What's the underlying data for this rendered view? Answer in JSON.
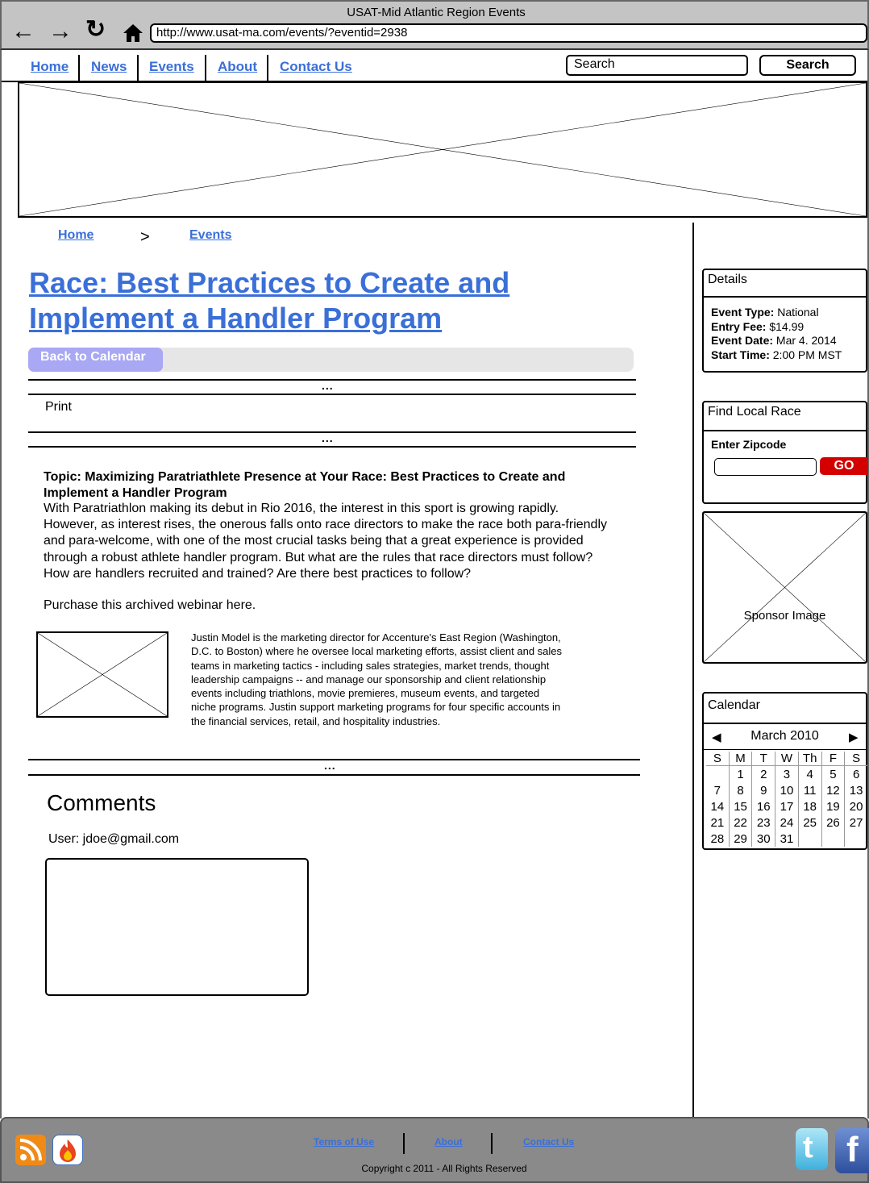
{
  "window": {
    "title": "USAT-Mid Atlantic Region Events",
    "url": "http://www.usat-ma.com/events/?eventid=2938"
  },
  "nav": {
    "items": [
      "Home",
      "News",
      "Events",
      "About",
      "Contact Us"
    ],
    "search_placeholder": "Search",
    "search_button": "Search"
  },
  "breadcrumb": {
    "home": "Home",
    "separator": ">",
    "events": "Events"
  },
  "event": {
    "title_line1": "Race: Best Practices to Create and",
    "title_line2": "Implement a Handler Program",
    "back_button": "Back to Calendar",
    "print_label": "Print",
    "dots": "...",
    "topic_line1": "Topic: Maximizing Paratriathlete Presence at Your Race: Best Practices to Create and",
    "topic_line2": "Implement a Handler Program",
    "body": [
      "With Paratriathlon making its debut in Rio 2016, the interest in this sport is growing rapidly.",
      "However, as interest rises, the onerous falls onto race directors to make the race both para-friendly",
      "and para-welcome, with one of the most crucial tasks being that a great experience is provided",
      "through a robust athlete handler program.  But what are the rules that race directors must follow?",
      "How are handlers recruited and trained?  Are there best practices to follow?"
    ],
    "purchase_text": "Purchase this archived webinar here.",
    "bio": [
      "Justin Model is the marketing director for Accenture's East Region (Washington,",
      "D.C. to Boston) where he oversee local marketing efforts, assist client and sales",
      "teams in marketing tactics - including sales strategies, market trends, thought",
      "leadership campaigns -- and manage our sponsorship and client relationship",
      "events including triathlons, movie premieres, museum events, and targeted",
      "niche programs. Justin support marketing programs for four specific accounts in",
      "the financial services, retail, and hospitality industries."
    ]
  },
  "comments": {
    "heading": "Comments",
    "user_label": "User: jdoe@gmail.com"
  },
  "details": {
    "title": "Details",
    "rows": [
      {
        "label": "Event Type:",
        "value": " National"
      },
      {
        "label": "Entry Fee:",
        "value": " $14.99"
      },
      {
        "label": "Event Date:",
        "value": " Mar 4. 2014"
      },
      {
        "label": "Start Time:",
        "value": " 2:00 PM MST"
      }
    ]
  },
  "find_race": {
    "title": "Find Local Race",
    "label": "Enter Zipcode",
    "go": "GO"
  },
  "sponsor": {
    "label": "Sponsor Image"
  },
  "calendar": {
    "title": "Calendar",
    "month": "March 2010",
    "days": [
      "S",
      "M",
      "T",
      "W",
      "Th",
      "F",
      "S"
    ],
    "weeks": [
      [
        "",
        "1",
        "2",
        "3",
        "4",
        "5",
        "6"
      ],
      [
        "7",
        "8",
        "9",
        "10",
        "11",
        "12",
        "13"
      ],
      [
        "14",
        "15",
        "16",
        "17",
        "18",
        "19",
        "20"
      ],
      [
        "21",
        "22",
        "23",
        "24",
        "25",
        "26",
        "27"
      ],
      [
        "28",
        "29",
        "30",
        "31",
        "",
        "",
        ""
      ]
    ]
  },
  "footer": {
    "links": [
      "Terms of Use",
      "About",
      "Contact Us"
    ],
    "copyright": "Copyright c 2011 - All Rights Reserved"
  },
  "colors": {
    "link": "#3a6fd8",
    "back_button": "#a8a8f4",
    "go_button": "#d40000",
    "footer_bg": "#8a8a8a",
    "chrome_bg": "#c4c4c4"
  }
}
